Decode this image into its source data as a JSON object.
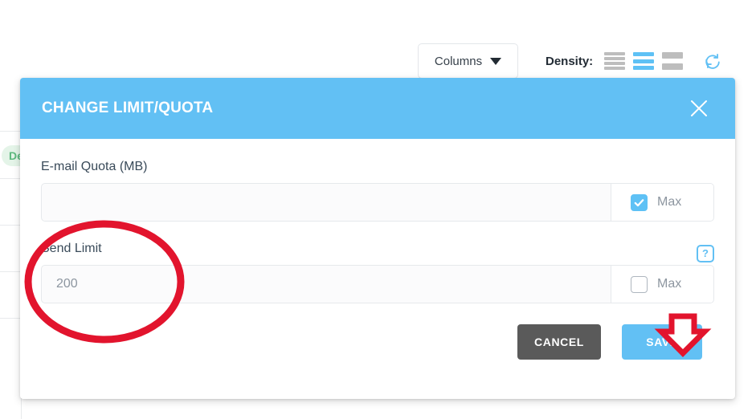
{
  "toolbar": {
    "columns_button_label": "Columns",
    "columns_caret_icon": "chevron-down-icon",
    "density_label": "Density:",
    "density_options": [
      {
        "name": "compact",
        "selected": false
      },
      {
        "name": "standard",
        "selected": true
      },
      {
        "name": "comfortable",
        "selected": false
      }
    ],
    "refresh_icon": "refresh-icon"
  },
  "background": {
    "status_badge_text": "De",
    "row_line_count": 6
  },
  "modal": {
    "title": "CHANGE LIMIT/QUOTA",
    "close_icon": "close-icon",
    "fields": [
      {
        "label": "E-mail Quota (MB)",
        "value": "",
        "placeholder": "",
        "adornment_label": "Max",
        "checked": true,
        "has_help_icon": false
      },
      {
        "label": "Send Limit",
        "value": "",
        "placeholder": "200",
        "adornment_label": "Max",
        "checked": false,
        "has_help_icon": true,
        "help_icon_glyph": "?"
      }
    ],
    "cancel_label": "CANCEL",
    "save_label": "SAVE"
  },
  "annotations": {
    "circle_target": "send-limit-field",
    "arrow_target": "save-button",
    "color": "#e2142d"
  },
  "colors": {
    "accent": "#62c0f4",
    "header": "#62c0f4",
    "cancel": "#5a5a5a",
    "badge_bg": "#e4f4e8",
    "badge_text": "#5eb97f",
    "annotation_red": "#e2142d"
  }
}
